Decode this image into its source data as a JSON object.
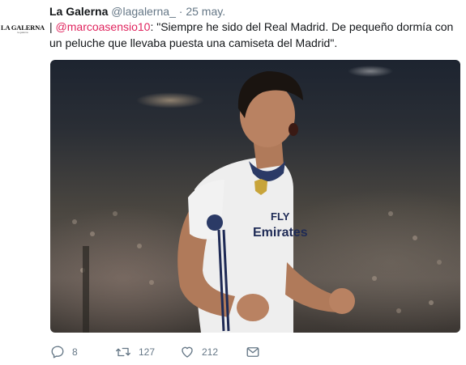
{
  "account": {
    "logo_text": "LA GALERNA",
    "logo_sub": "la galerna",
    "name": "La Galerna",
    "handle": "@lagalerna_",
    "separator": "·",
    "date": "25 may."
  },
  "tweet": {
    "prefix": "| ",
    "mention": "@marcoasensio10",
    "text": ": \"Siempre he sido del Real Madrid. De pequeño dormía con un peluche que llevaba puesta una camiseta del Madrid\"."
  },
  "actions": {
    "reply_count": "8",
    "retweet_count": "127",
    "like_count": "212"
  },
  "colors": {
    "mention": "#e0245e",
    "secondary_text": "#657786",
    "primary_text": "#14171a"
  },
  "icons": [
    "reply-icon",
    "retweet-icon",
    "heart-icon",
    "envelope-icon"
  ]
}
